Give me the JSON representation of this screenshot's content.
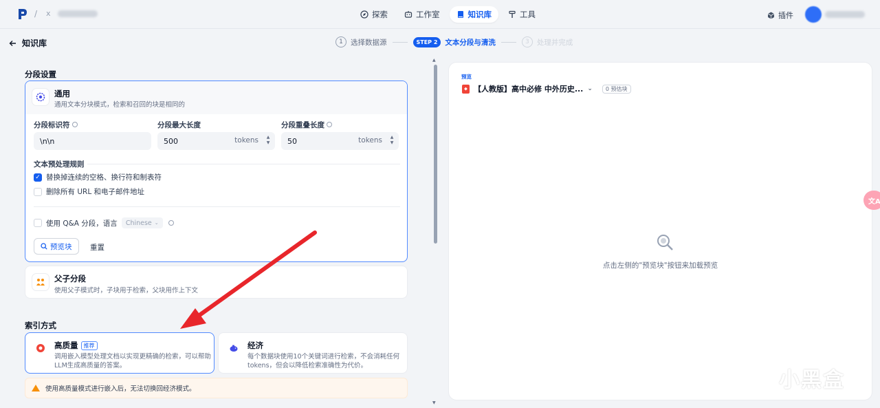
{
  "header": {
    "workspace_separator": "/",
    "workspace_x": "x",
    "nav": [
      {
        "label": "探索",
        "icon": "compass-icon",
        "active": false
      },
      {
        "label": "工作室",
        "icon": "robot-icon",
        "active": true
      },
      {
        "label": "知识库",
        "icon": "book-icon",
        "active": true
      },
      {
        "label": "工具",
        "icon": "hammer-icon",
        "active": false
      }
    ],
    "plugin_label": "插件"
  },
  "page": {
    "back_label": "知识库",
    "steps": [
      {
        "num": "1",
        "label": "选择数据源"
      },
      {
        "num": "STEP 2",
        "label": "文本分段与清洗"
      },
      {
        "num": "3",
        "label": "处理并完成"
      }
    ]
  },
  "segmentation": {
    "section_title": "分段设置",
    "general": {
      "title": "通用",
      "desc": "通用文本分块模式，检索和召回的块是相同的",
      "delimiter_label": "分段标识符",
      "delimiter_value": "\\n\\n",
      "max_length_label": "分段最大长度",
      "max_length_value": "500",
      "overlap_label": "分段重叠长度",
      "overlap_value": "50",
      "unit": "tokens",
      "rules_title": "文本预处理规则",
      "rule_1": "替换掉连续的空格、换行符和制表符",
      "rule_2": "删除所有 URL 和电子邮件地址",
      "qa_label": "使用 Q&A 分段，语言",
      "qa_language": "Chinese",
      "preview_button": "预览块",
      "reset_button": "重置"
    },
    "parent_child": {
      "title": "父子分段",
      "desc": "使用父子模式时，子块用于检索，父块用作上下文"
    }
  },
  "index": {
    "section_title": "索引方式",
    "high_quality": {
      "title": "高质量",
      "badge": "推荐",
      "desc_1": "调用嵌入模型处理文档以实现更精确的检索，可以帮助",
      "desc_2": "LLM生成高质量的答案。"
    },
    "economy": {
      "title": "经济",
      "desc_1": "每个数据块使用10个关键词进行检索，不会消耗任何",
      "desc_2": "tokens，但会以降低检索准确性为代价。"
    },
    "warning": "使用高质量模式进行嵌入后，无法切换回经济模式。"
  },
  "preview": {
    "label": "预览",
    "doc_name": "【人教版】高中必修 中外历史...",
    "chunk_count": "0 预估块",
    "empty_text": "点击左侧的\"预览块\"按钮来加载预览"
  },
  "float_button": "文A",
  "watermark": {
    "text": "小黑盒"
  },
  "colors": {
    "accent": "#155eef",
    "annotation_arrow": "#e8262b",
    "warning": "#f79009"
  }
}
